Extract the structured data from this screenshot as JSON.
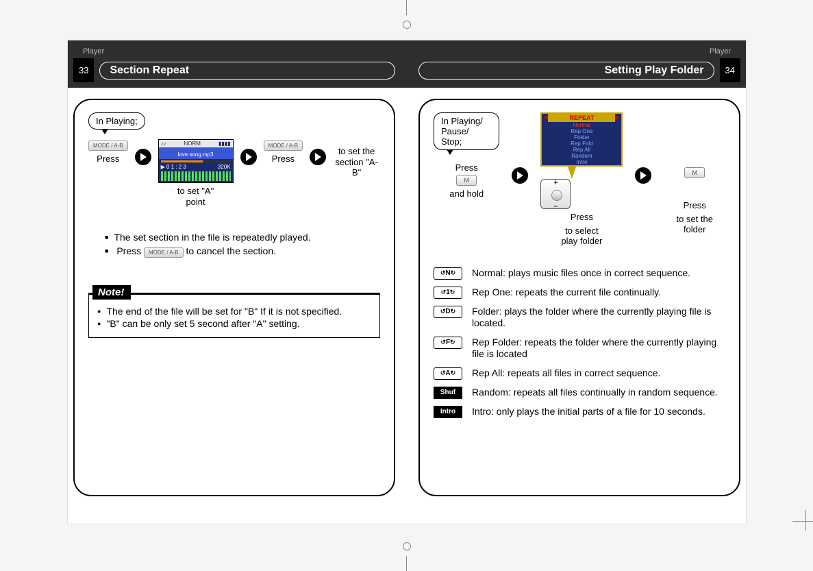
{
  "left": {
    "page_num": "33",
    "tag": "Player",
    "title": "Section Repeat",
    "bubble": "In Playing;",
    "press": "Press",
    "mode_btn": "MODE / A-B",
    "set_a": "to set \"A\"\npoint",
    "set_ab": "to set the\nsection \"A-B\"",
    "sq_list": [
      "The set section in the file is repeatedly played.",
      "Press           to cancel the section."
    ],
    "note_label": "Note!",
    "note_items": [
      "The end of the file will be set for \"B\" If it is not specified.",
      "\"B\" can be only set 5 second after \"A\" setting."
    ],
    "lcd": {
      "norm": "NORM",
      "song": "love song.mp3",
      "rate": "320K",
      "time": "0 1 : 2 3"
    }
  },
  "right": {
    "page_num": "34",
    "tag": "Player",
    "title": "Setting Play Folder",
    "bubble": "In Playing/\nPause/ Stop;",
    "press": "Press",
    "and_hold": "and hold",
    "step2": "to select\nplay folder",
    "step3": "to set the folder",
    "m_btn": "M",
    "menu_title": "REPEAT",
    "menu_items": [
      "Normal",
      "Rep One",
      "Folder",
      "Rep Fold",
      "Rep All",
      "Random",
      "Intro"
    ],
    "modes": [
      {
        "ic": "N",
        "style": "box",
        "text": "Normal: plays music files once in correct sequence."
      },
      {
        "ic": "1",
        "style": "box",
        "text": "Rep One: repeats the current file continually."
      },
      {
        "ic": "D",
        "style": "box",
        "text": "Folder: plays the folder where the currently playing file is located."
      },
      {
        "ic": "F",
        "style": "box",
        "text": "Rep Folder: repeats the folder where the currently playing file is located"
      },
      {
        "ic": "A",
        "style": "box",
        "text": "Rep All: repeats all files in correct sequence."
      },
      {
        "ic": "Shuf",
        "style": "inv",
        "text": "Random: repeats all files continually in random sequence."
      },
      {
        "ic": "Intro",
        "style": "inv",
        "text": "Intro: only plays the initial parts of a file for 10 seconds."
      }
    ]
  }
}
